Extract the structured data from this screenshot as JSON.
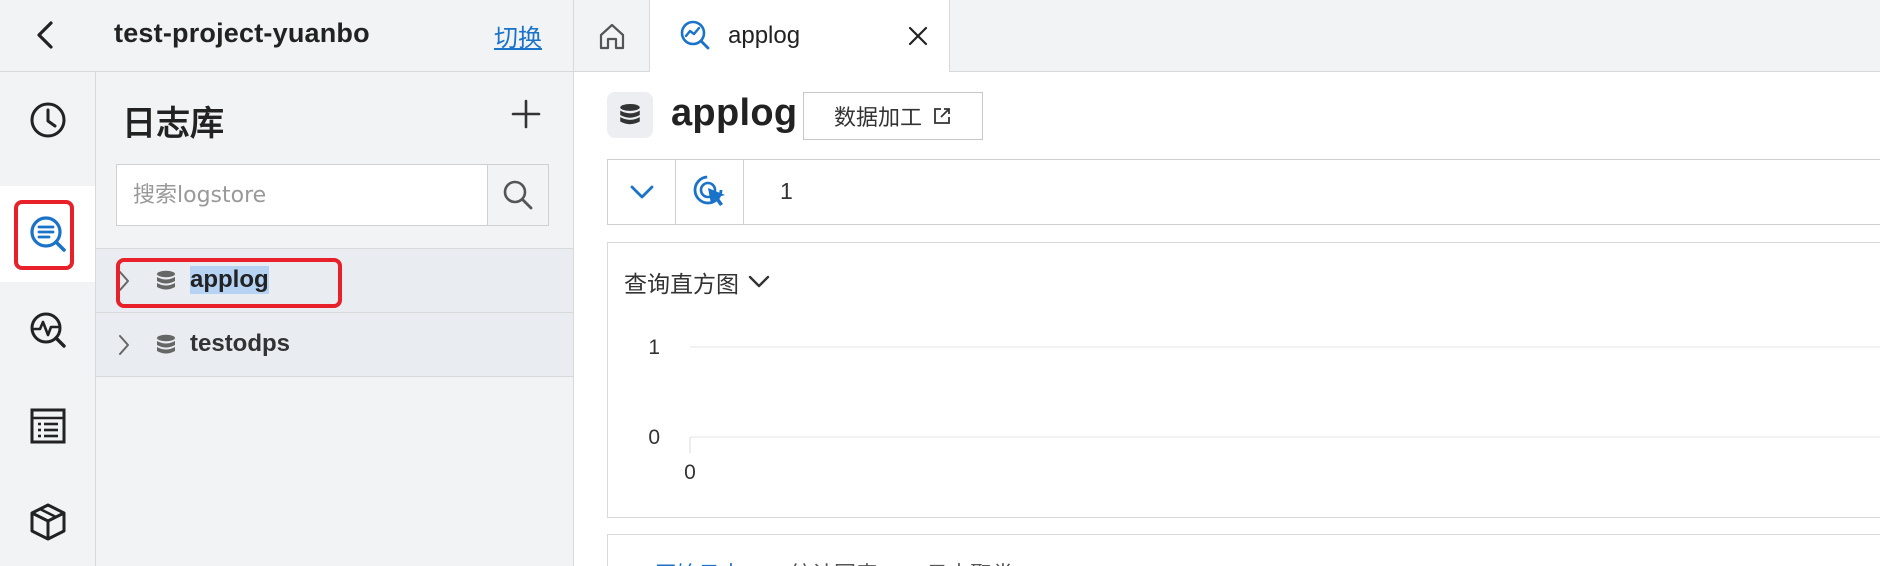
{
  "project": {
    "name": "test-project-yuanbo",
    "switch_label": "切换"
  },
  "tabs": [
    {
      "label": "applog",
      "icon": "query-chart-icon"
    }
  ],
  "rail": {
    "items": [
      "clock-icon",
      "logstore-search-icon",
      "monitor-search-icon",
      "report-list-icon",
      "package-box-icon"
    ],
    "active_index": 1
  },
  "panel": {
    "title": "日志库",
    "search_placeholder": "搜索logstore",
    "logstores": [
      {
        "name": "applog",
        "selected": true
      },
      {
        "name": "testodps",
        "selected": false
      }
    ]
  },
  "main": {
    "title": "applog",
    "process_button": "数据加工",
    "query_line_number": "1",
    "histogram_title": "查询直方图"
  },
  "chart_data": {
    "type": "bar",
    "title": "查询直方图",
    "x_ticks": [
      "0"
    ],
    "y_ticks": [
      "1",
      "0"
    ],
    "ylim": [
      0,
      1
    ],
    "values": [],
    "grid": true
  },
  "bottom": {
    "tabs": [
      "原始日志",
      "统计图表",
      "日志聚类"
    ]
  },
  "colors": {
    "accent": "#1a73c9",
    "highlight": "#e8202a",
    "sidebar_bg": "#f2f3f5",
    "selection": "#b7d3f4"
  }
}
